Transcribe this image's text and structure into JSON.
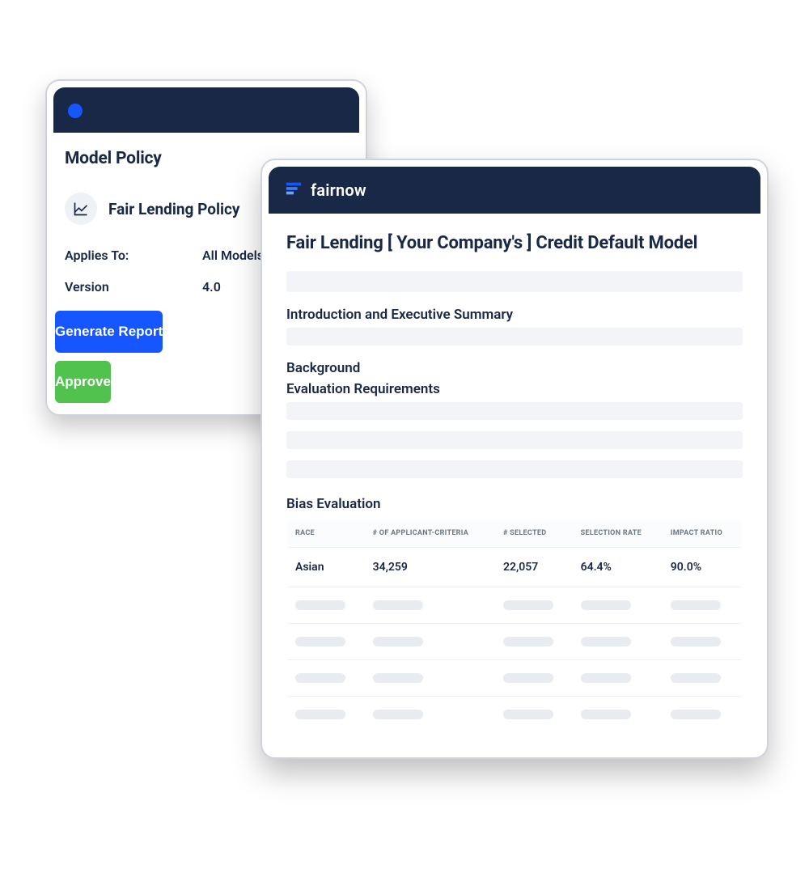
{
  "policy_card": {
    "title": "Model Policy",
    "policy_name": "Fair Lending Policy",
    "meta": [
      {
        "label": "Applies To:",
        "value": "All Models"
      },
      {
        "label": "Version",
        "value": "4.0"
      }
    ],
    "generate_label": "Generate Report",
    "approve_label": "Approve"
  },
  "report_card": {
    "brand": "fairnow",
    "title": "Fair Lending [ Your Company's ] Credit Default Model",
    "section_intro": "Introduction and Executive Summary",
    "section_bg": "Background",
    "section_req": "Evaluation Requirements",
    "section_bias": "Bias Evaluation",
    "bias_table": {
      "columns": [
        "RACE",
        "# OF APPLICANT-CRITERIA",
        "# SELECTED",
        "SELECTION RATE",
        "IMPACT RATIO"
      ],
      "rows": [
        {
          "race": "Asian",
          "applicants": "34,259",
          "selected": "22,057",
          "rate": "64.4%",
          "impact": "90.0%"
        }
      ],
      "placeholder_row_count": 4
    }
  }
}
